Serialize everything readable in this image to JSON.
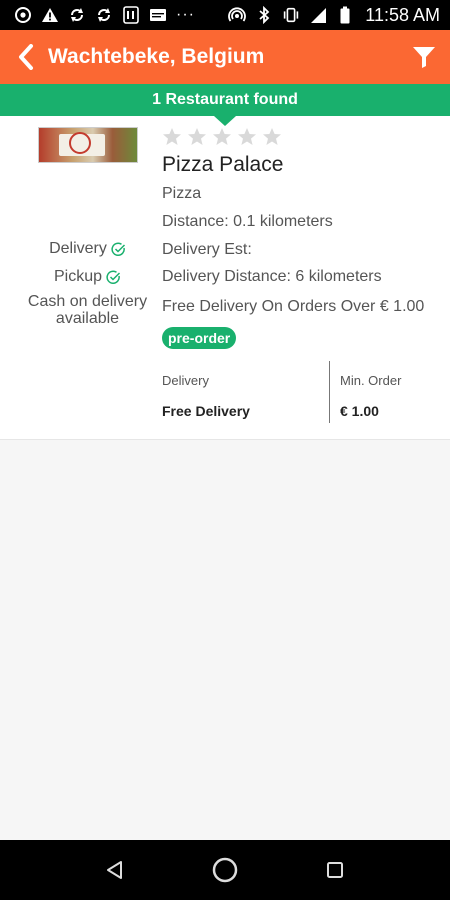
{
  "status_bar": {
    "time": "11:58 AM",
    "left_icons": [
      "chrome-icon",
      "warning-icon",
      "sync-icon",
      "sync-icon",
      "tj-app-icon",
      "news-app-icon",
      "more-dots-icon"
    ],
    "right_icons": [
      "hotspot-icon",
      "bluetooth-icon",
      "vibrate-icon",
      "signal-icon",
      "battery-icon"
    ],
    "more_dots": "···"
  },
  "app_bar": {
    "title": "Wachtebeke, Belgium",
    "back_icon": "chevron-left-icon",
    "filter_icon": "filter-icon",
    "background": "#fb6833"
  },
  "banner": {
    "text": "1 Restaurant found",
    "background": "#19b06d"
  },
  "restaurant": {
    "name": "Pizza Palace",
    "rating_stars_filled": 0,
    "rating_stars_total": 5,
    "cuisine": "Pizza",
    "distance": "Distance: 0.1 kilometers",
    "delivery_est": "Delivery Est:",
    "delivery_distance": "Delivery Distance: 6 kilometers",
    "free_delivery_note": "Free Delivery On Orders Over € 1.00",
    "badge": "pre-order",
    "options": {
      "delivery": "Delivery",
      "pickup": "Pickup",
      "cash_line1": "Cash on delivery",
      "cash_line2": "available"
    },
    "table": {
      "delivery_label": "Delivery",
      "delivery_value": "Free Delivery",
      "min_order_label": "Min. Order",
      "min_order_value": "€ 1.00"
    }
  },
  "nav_bar": {
    "buttons": [
      "back-triangle-icon",
      "home-circle-icon",
      "recents-square-icon"
    ]
  }
}
